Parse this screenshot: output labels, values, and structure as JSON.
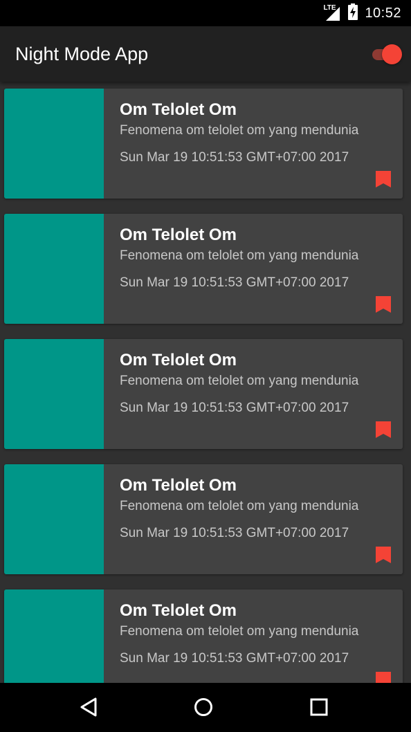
{
  "status_bar": {
    "network": "LTE",
    "time": "10:52"
  },
  "app_bar": {
    "title": "Night Mode App",
    "night_mode_toggle": {
      "checked": true,
      "accent_color": "#f44336"
    }
  },
  "colors": {
    "background": "#303030",
    "app_bar": "#212121",
    "card": "#424242",
    "thumbnail": "#009688",
    "accent": "#f44336"
  },
  "items": [
    {
      "title": "Om Telolet Om",
      "subtitle": "Fenomena om telolet om yang mendunia",
      "date": "Sun Mar 19 10:51:53 GMT+07:00 2017",
      "icon": "bookmark-icon"
    },
    {
      "title": "Om Telolet Om",
      "subtitle": "Fenomena om telolet om yang mendunia",
      "date": "Sun Mar 19 10:51:53 GMT+07:00 2017",
      "icon": "bookmark-icon"
    },
    {
      "title": "Om Telolet Om",
      "subtitle": "Fenomena om telolet om yang mendunia",
      "date": "Sun Mar 19 10:51:53 GMT+07:00 2017",
      "icon": "bookmark-icon"
    },
    {
      "title": "Om Telolet Om",
      "subtitle": "Fenomena om telolet om yang mendunia",
      "date": "Sun Mar 19 10:51:53 GMT+07:00 2017",
      "icon": "bookmark-icon"
    },
    {
      "title": "Om Telolet Om",
      "subtitle": "Fenomena om telolet om yang mendunia",
      "date": "Sun Mar 19 10:51:53 GMT+07:00 2017",
      "icon": "bookmark-icon"
    }
  ],
  "nav_bar": {
    "buttons": [
      "back-icon",
      "home-icon",
      "recents-icon"
    ]
  }
}
